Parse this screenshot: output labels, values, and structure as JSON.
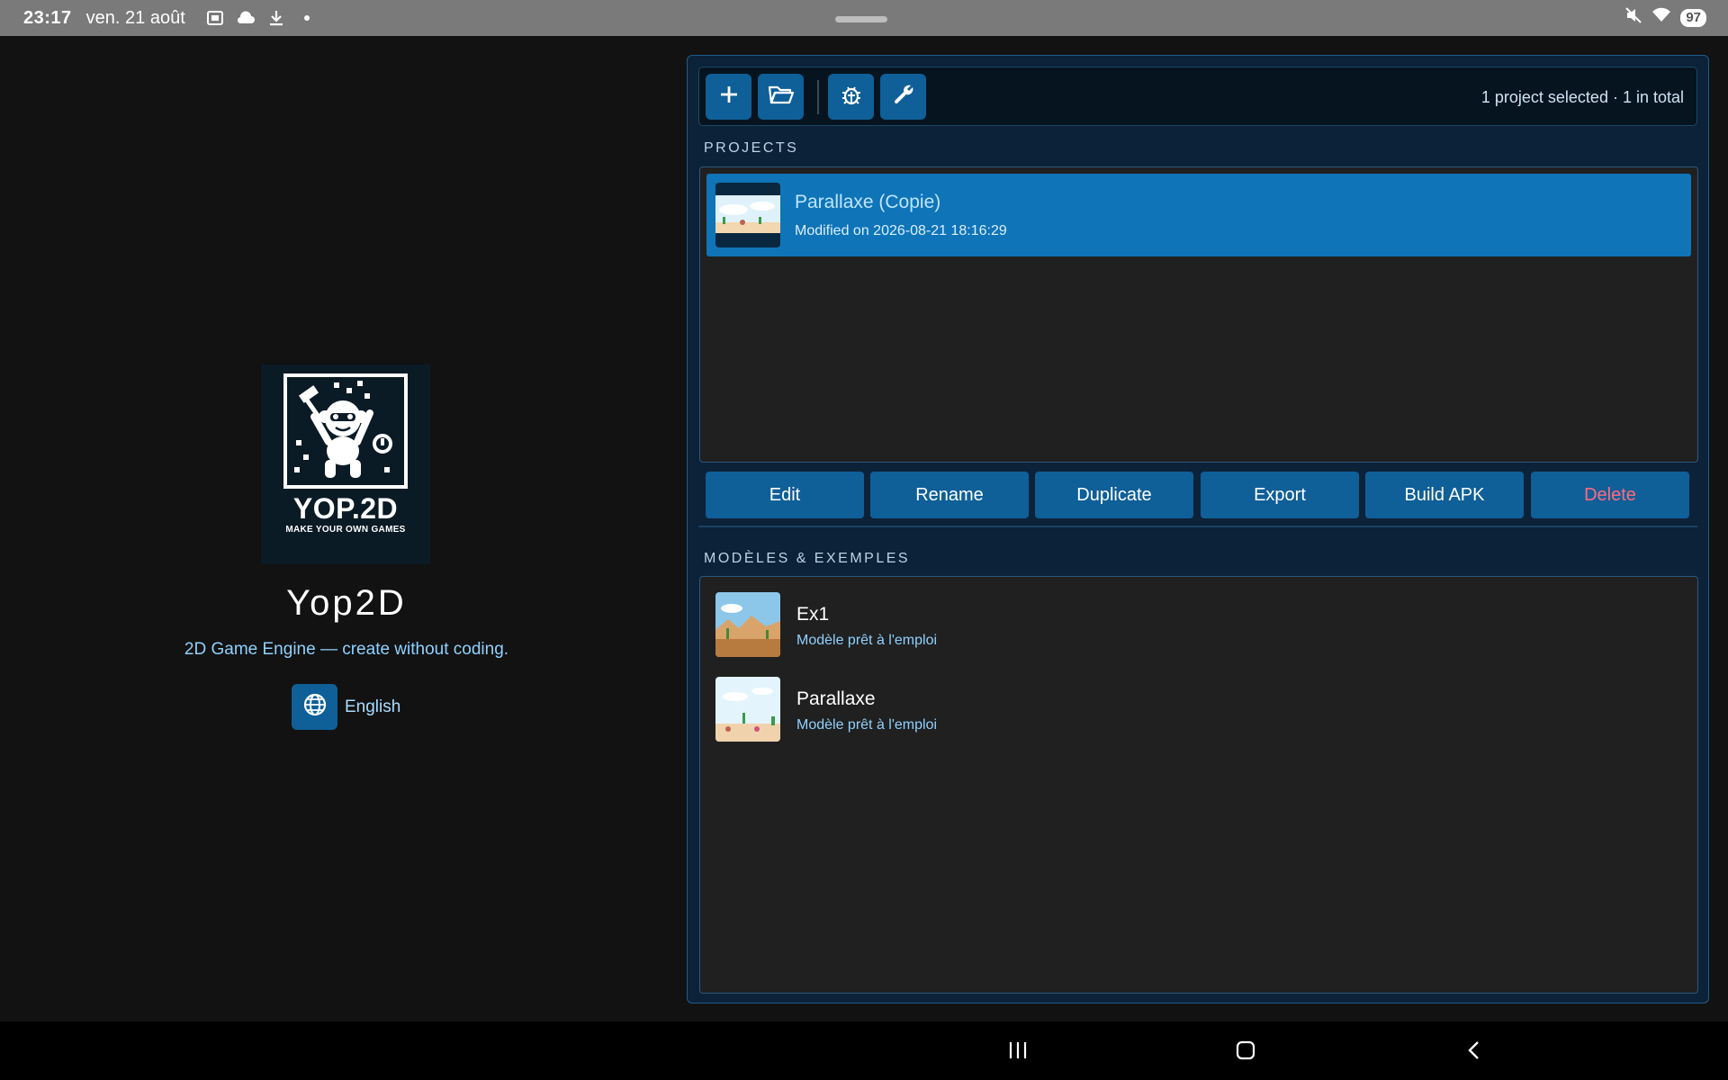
{
  "status_bar": {
    "time": "23:17",
    "date": "ven. 21 août",
    "battery": "97",
    "icons": [
      "screenshot-icon",
      "cloud-icon",
      "download-icon",
      "dot-icon",
      "mute-icon",
      "wifi-icon"
    ]
  },
  "branding": {
    "logo_text": "YOP.2D",
    "logo_tagline": "MAKE YOUR OWN GAMES",
    "app_title": "Yop2D",
    "tagline": "2D Game Engine — create without coding.",
    "language": "English"
  },
  "toolbar": {
    "buttons": [
      "add-icon",
      "folder-icon",
      "bug-icon",
      "wrench-icon"
    ],
    "status": "1 project selected · 1 in total"
  },
  "projects": {
    "section_label": "PROJECTS",
    "items": [
      {
        "title": "Parallaxe (Copie)",
        "subtitle": "Modified on 2026-08-21 18:16:29",
        "selected": true
      }
    ]
  },
  "actions": {
    "edit": "Edit",
    "rename": "Rename",
    "duplicate": "Duplicate",
    "export": "Export",
    "build_apk": "Build APK",
    "delete": "Delete"
  },
  "templates": {
    "section_label": "MODÈLES & EXEMPLES",
    "items": [
      {
        "title": "Ex1",
        "subtitle": "Modèle prêt à l'emploi"
      },
      {
        "title": "Parallaxe",
        "subtitle": "Modèle prêt à l'emploi"
      }
    ]
  },
  "colors": {
    "accent": "#0f5f98",
    "selected": "#0f74b8",
    "danger": "#ff6b7e"
  }
}
